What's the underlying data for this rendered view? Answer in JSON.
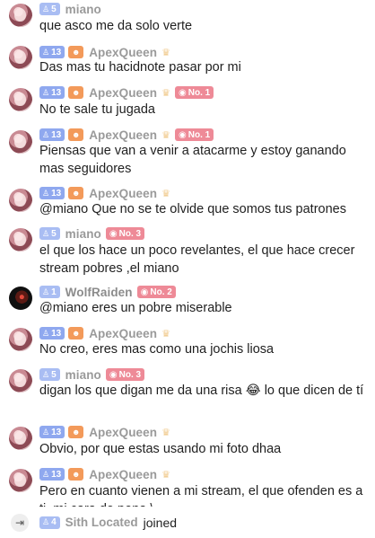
{
  "messages": [
    {
      "user": "miano",
      "level": "5",
      "level_light": true,
      "has_fan": false,
      "has_crown": false,
      "rank": "",
      "avatar": "pink",
      "text": "que asco me da solo verte"
    },
    {
      "user": "ApexQueen",
      "level": "13",
      "level_light": false,
      "has_fan": true,
      "has_crown": true,
      "rank": "",
      "avatar": "pink",
      "text": "Das mas tu hacidnote pasar por mi"
    },
    {
      "user": "ApexQueen",
      "level": "13",
      "level_light": false,
      "has_fan": true,
      "has_crown": true,
      "rank": "No. 1",
      "avatar": "pink",
      "text": "No te sale tu jugada"
    },
    {
      "user": "ApexQueen",
      "level": "13",
      "level_light": false,
      "has_fan": true,
      "has_crown": true,
      "rank": "No. 1",
      "avatar": "pink",
      "text": "Piensas que van a venir a atacarme y estoy ganando mas seguidores"
    },
    {
      "user": "ApexQueen",
      "level": "13",
      "level_light": false,
      "has_fan": true,
      "has_crown": true,
      "rank": "",
      "avatar": "pink",
      "text": "@miano Que no se te olvide que somos tus patrones"
    },
    {
      "user": "miano",
      "level": "5",
      "level_light": true,
      "has_fan": false,
      "has_crown": false,
      "rank": "No. 3",
      "avatar": "pink",
      "text": "el que los hace un poco revelantes, el que hace crecer stream pobres ,el miano"
    },
    {
      "user": "WolfRaiden",
      "level": "1",
      "level_light": true,
      "has_fan": false,
      "has_crown": false,
      "rank": "No. 2",
      "avatar": "dark",
      "text": "@miano eres un pobre miserable"
    },
    {
      "user": "ApexQueen",
      "level": "13",
      "level_light": false,
      "has_fan": true,
      "has_crown": true,
      "rank": "",
      "avatar": "pink",
      "text": "No creo, eres mas como una jochis liosa"
    },
    {
      "user": "miano",
      "level": "5",
      "level_light": true,
      "has_fan": false,
      "has_crown": false,
      "rank": "No. 3",
      "avatar": "pink",
      "text": "digan los que digan me da una risa 😂 lo que dicen de tí"
    },
    {
      "user": "ApexQueen",
      "level": "13",
      "level_light": false,
      "has_fan": true,
      "has_crown": true,
      "rank": "",
      "avatar": "pink",
      "text": "Obvio, por que estas usando mi foto dhaa"
    },
    {
      "user": "ApexQueen",
      "level": "13",
      "level_light": false,
      "has_fan": true,
      "has_crown": true,
      "rank": "",
      "avatar": "pink",
      "text": "Pero en cuanto vienen a mi stream, el que ofenden es a ti, mi cara de pena \\"
    }
  ],
  "join_event": {
    "level": "4",
    "user": "Sith Located",
    "action": "joined"
  },
  "icons": {
    "level": "person-icon",
    "fan": "fan-club-icon",
    "crown": "crown-icon",
    "rank": "gift-rank-icon",
    "enter": "enter-icon"
  },
  "colors": {
    "level_badge": "#8fa8ef",
    "fan_badge": "#f39a5a",
    "rank_badge": "#ee8a97",
    "username": "#9a9a9a"
  }
}
